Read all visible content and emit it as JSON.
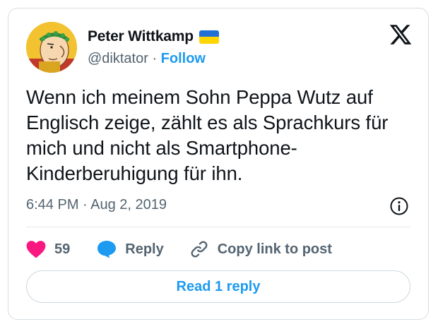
{
  "author": {
    "name": "Peter Wittkamp",
    "handle": "@diktator",
    "separator": " · ",
    "follow_label": "Follow",
    "flag_icon": "ukraine-flag-icon"
  },
  "tweet": {
    "text": "Wenn ich meinem Sohn Peppa Wutz auf Englisch zeige, zählt es als Sprachkurs für mich und nicht als Smartphone-Kinderberuhigung für ihn.",
    "time": "6:44 PM",
    "date_separator": " · ",
    "date": "Aug 2, 2019"
  },
  "actions": {
    "likes_count": "59",
    "reply_label": "Reply",
    "copy_link_label": "Copy link to post"
  },
  "read_replies_label": "Read 1 reply",
  "icons": {
    "brand": "x-logo-icon",
    "info": "info-icon",
    "like": "heart-icon",
    "reply": "speech-bubble-icon",
    "link": "link-icon"
  },
  "colors": {
    "accent": "#1d9bf0",
    "heart": "#f91880",
    "text_primary": "#0f1419",
    "text_secondary": "#536471",
    "border": "#cfd9de",
    "flag_blue": "#1f6fd6",
    "flag_yellow": "#ffd500"
  }
}
